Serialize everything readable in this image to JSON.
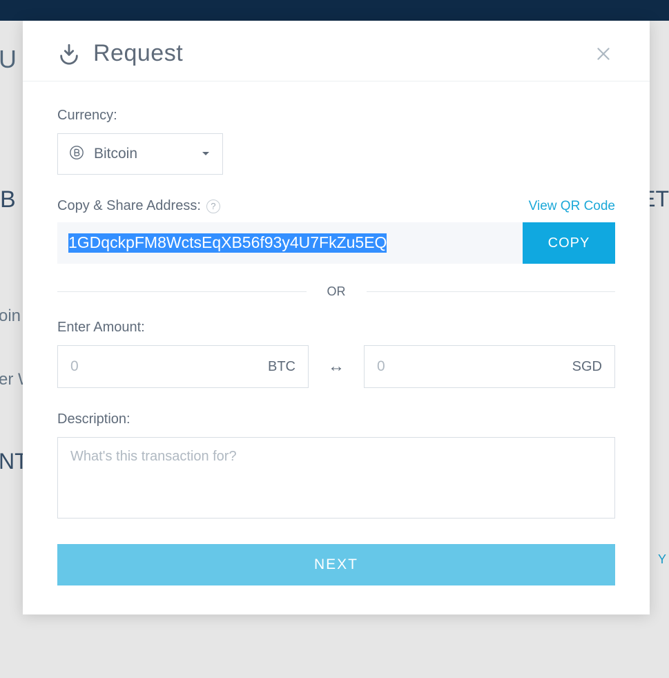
{
  "modal": {
    "title": "Request",
    "currency_label": "Currency:",
    "currency_selected": "Bitcoin",
    "address_label": "Copy & Share Address:",
    "qr_link": "View QR Code",
    "address_value": "1GDqckpFM8WctsEqXB56f93y4U7FkZu5EQ",
    "copy_label": "COPY",
    "or_label": "OR",
    "amount_label": "Enter Amount:",
    "amount_btc_placeholder": "0",
    "amount_btc_unit": "BTC",
    "amount_fiat_placeholder": "0",
    "amount_fiat_unit": "SGD",
    "description_label": "Description:",
    "description_placeholder": "What's this transaction for?",
    "next_label": "NEXT"
  },
  "background": {
    "frag1": "U",
    "frag2": "B",
    "frag3": "ET",
    "frag4": "oin",
    "frag5": "er W",
    "frag6": "NT",
    "frag7": "Y"
  }
}
